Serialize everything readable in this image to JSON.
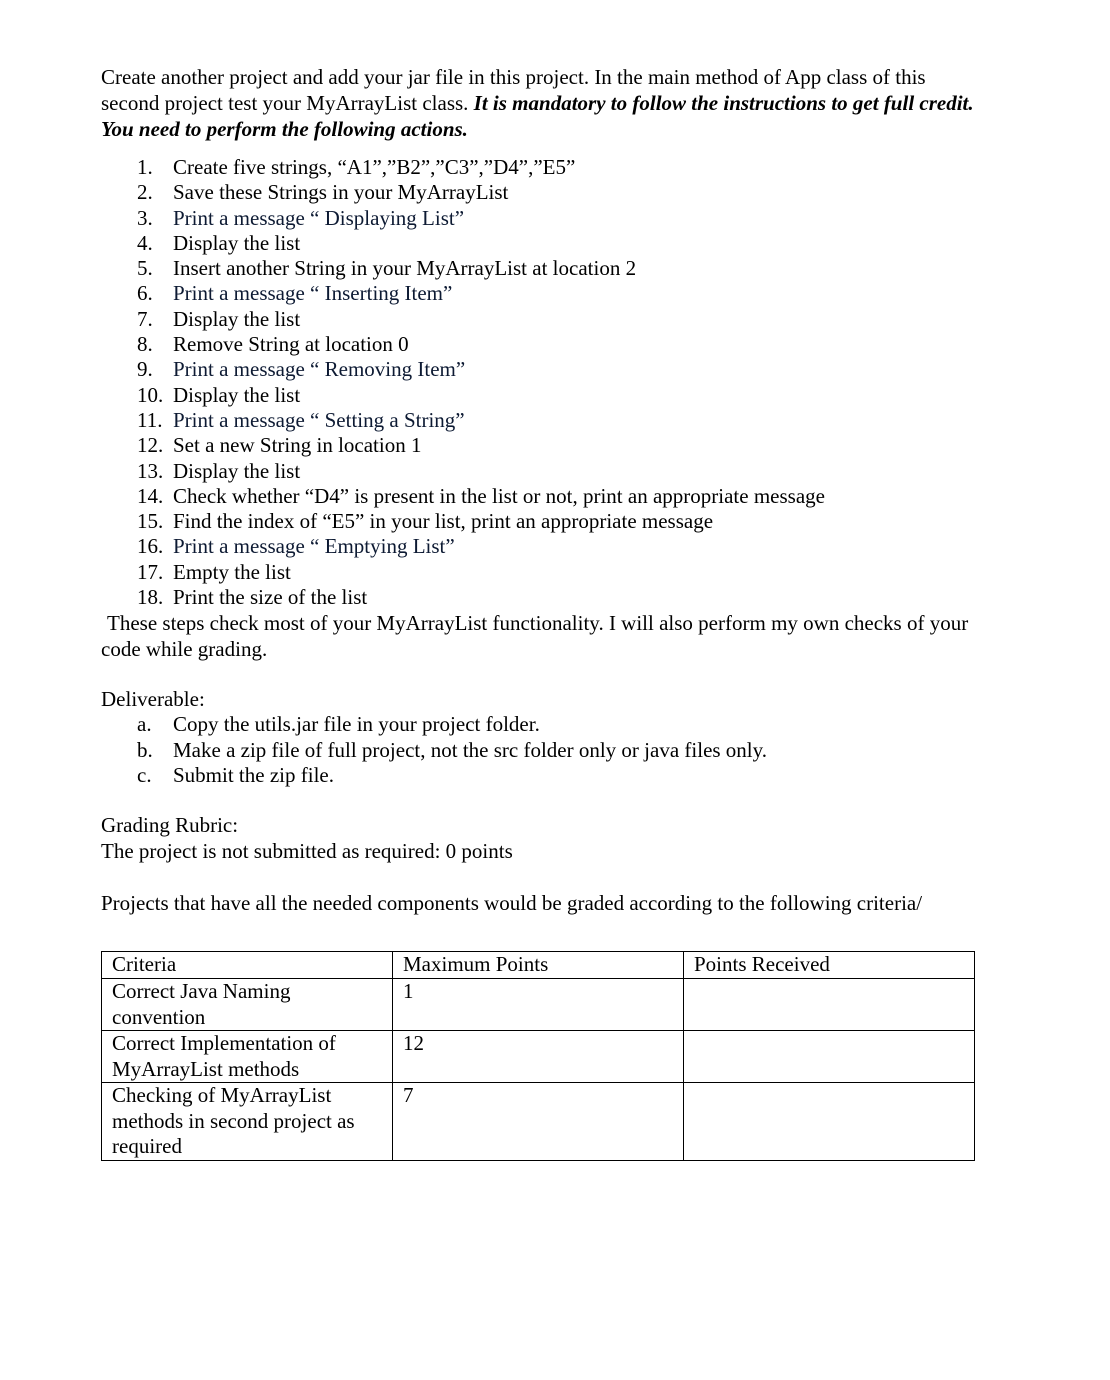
{
  "intro": {
    "text_plain": "Create another project and add your jar file in this project. In the main method of App class of this second project test your MyArrayList class. ",
    "text_emphasis": "It is mandatory to follow the instructions to get full credit. You need to perform the following actions."
  },
  "steps": [
    {
      "num": "1.",
      "text": "Create five strings,  “A1”,”B2”,”C3”,”D4”,”E5”"
    },
    {
      "num": "2.",
      "text": "Save these Strings in your MyArrayList"
    },
    {
      "num": "3.",
      "text": "Print a message “ Displaying List”"
    },
    {
      "num": "4.",
      "text": "Display the list"
    },
    {
      "num": "5.",
      "text": "Insert another String in your MyArrayList at location 2"
    },
    {
      "num": "6.",
      "text": "Print a message “ Inserting Item”"
    },
    {
      "num": "7.",
      "text": "Display the list"
    },
    {
      "num": "8.",
      "text": "Remove String at location 0"
    },
    {
      "num": "9.",
      "text": "Print a message “ Removing Item”"
    },
    {
      "num": "10.",
      "text": "Display the list"
    },
    {
      "num": "11.",
      "text": "Print a message “ Setting a String”"
    },
    {
      "num": "12.",
      "text": "Set a new String in location 1"
    },
    {
      "num": "13.",
      "text": "Display the list"
    },
    {
      "num": "14.",
      "text": "Check whether “D4” is present in the list or not, print an appropriate message"
    },
    {
      "num": "15.",
      "text": "Find the index of “E5” in your list, print an appropriate message"
    },
    {
      "num": "16.",
      "text": "Print a message “ Emptying List”"
    },
    {
      "num": "17.",
      "text": "Empty the list"
    },
    {
      "num": "18.",
      "text": "Print the size of the list"
    }
  ],
  "summary": "These steps check most of your MyArrayList functionality. I will also perform my own checks of your code while grading.",
  "deliverable": {
    "label": "Deliverable:",
    "items": [
      {
        "num": "a.",
        "text": "Copy the utils.jar file in your project folder."
      },
      {
        "num": "b.",
        "text": "Make a zip file of full project, not the src folder only or java files only."
      },
      {
        "num": "c.",
        "text": "Submit the zip file."
      }
    ]
  },
  "rubric": {
    "label": "Grading Rubric:",
    "not_submitted": "The project is not submitted as required: 0 points",
    "criteria_intro": "Projects that have all the needed components would be graded according to the following criteria/",
    "table": {
      "headers": [
        "Criteria",
        "Maximum Points",
        "Points Received"
      ],
      "rows": [
        {
          "criteria": "Correct Java Naming convention",
          "max": "1",
          "received": ""
        },
        {
          "criteria": "Correct Implementation of MyArrayList methods",
          "max": "12",
          "received": ""
        },
        {
          "criteria": "Checking of MyArrayList methods in second project as required",
          "max": "7",
          "received": ""
        }
      ]
    }
  },
  "colors": {
    "text": "#000000",
    "navy_text": "#0d1a33",
    "border": "#000000"
  }
}
